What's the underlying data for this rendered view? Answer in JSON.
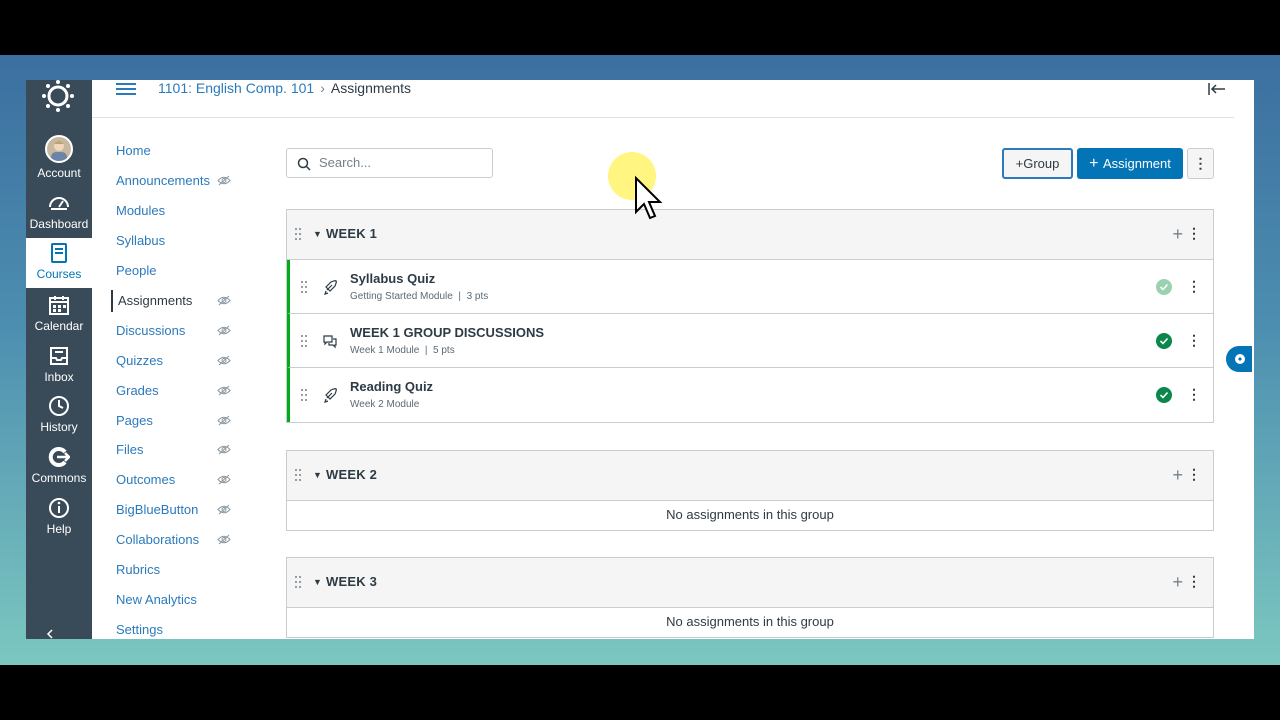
{
  "global_nav": [
    {
      "label": "Account",
      "icon": "avatar"
    },
    {
      "label": "Dashboard",
      "icon": "dashboard-icon"
    },
    {
      "label": "Courses",
      "icon": "courses-icon",
      "active": true
    },
    {
      "label": "Calendar",
      "icon": "calendar-icon"
    },
    {
      "label": "Inbox",
      "icon": "inbox-icon"
    },
    {
      "label": "History",
      "icon": "history-icon"
    },
    {
      "label": "Commons",
      "icon": "commons-icon"
    },
    {
      "label": "Help",
      "icon": "help-icon"
    }
  ],
  "breadcrumb": {
    "course": "1101: English Comp. 101",
    "page": "Assignments"
  },
  "course_nav": [
    {
      "label": "Home",
      "hidden": false
    },
    {
      "label": "Announcements",
      "hidden": true
    },
    {
      "label": "Modules",
      "hidden": false
    },
    {
      "label": "Syllabus",
      "hidden": false
    },
    {
      "label": "People",
      "hidden": false
    },
    {
      "label": "Assignments",
      "hidden": true,
      "active": true
    },
    {
      "label": "Discussions",
      "hidden": true
    },
    {
      "label": "Quizzes",
      "hidden": true
    },
    {
      "label": "Grades",
      "hidden": true
    },
    {
      "label": "Pages",
      "hidden": true
    },
    {
      "label": "Files",
      "hidden": true
    },
    {
      "label": "Outcomes",
      "hidden": true
    },
    {
      "label": "BigBlueButton",
      "hidden": true
    },
    {
      "label": "Collaborations",
      "hidden": true
    },
    {
      "label": "Rubrics",
      "hidden": false
    },
    {
      "label": "New Analytics",
      "hidden": false
    },
    {
      "label": "Settings",
      "hidden": false
    }
  ],
  "toolbar": {
    "search_placeholder": "Search...",
    "group_label": "Group",
    "assignment_label": "Assignment",
    "more_label": "⋮"
  },
  "groups": [
    {
      "title": "WEEK 1",
      "items": [
        {
          "title": "Syllabus Quiz",
          "module": "Getting Started Module",
          "points": "3 pts",
          "type": "quiz",
          "published": "partial"
        },
        {
          "title": "WEEK 1 GROUP DISCUSSIONS",
          "module": "Week 1 Module",
          "points": "5 pts",
          "type": "discussion",
          "published": "yes"
        },
        {
          "title": "Reading Quiz",
          "module": "Week 2 Module",
          "points": "",
          "type": "quiz",
          "published": "yes"
        }
      ]
    },
    {
      "title": "WEEK 2",
      "empty_text": "No assignments in this group",
      "items": []
    },
    {
      "title": "WEEK 3",
      "empty_text": "No assignments in this group",
      "items": []
    }
  ],
  "colors": {
    "accent": "#0374B5",
    "link": "#2B7ABC",
    "nav_bg": "#394B58",
    "published": "#00AC18"
  }
}
